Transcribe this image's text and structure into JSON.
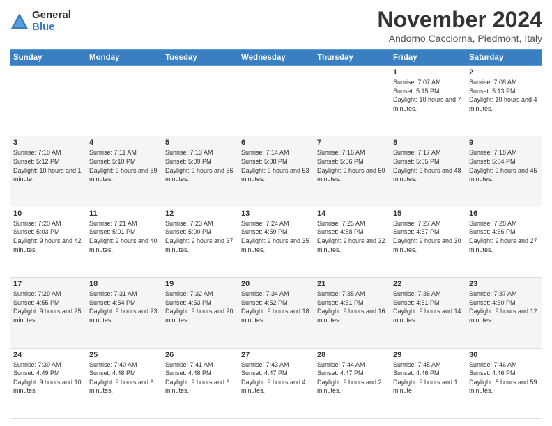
{
  "logo": {
    "general": "General",
    "blue": "Blue"
  },
  "title": "November 2024",
  "subtitle": "Andorno Cacciorna, Piedmont, Italy",
  "weekdays": [
    "Sunday",
    "Monday",
    "Tuesday",
    "Wednesday",
    "Thursday",
    "Friday",
    "Saturday"
  ],
  "weeks": [
    [
      {
        "day": "",
        "info": ""
      },
      {
        "day": "",
        "info": ""
      },
      {
        "day": "",
        "info": ""
      },
      {
        "day": "",
        "info": ""
      },
      {
        "day": "",
        "info": ""
      },
      {
        "day": "1",
        "info": "Sunrise: 7:07 AM\nSunset: 5:15 PM\nDaylight: 10 hours and 7 minutes."
      },
      {
        "day": "2",
        "info": "Sunrise: 7:08 AM\nSunset: 5:13 PM\nDaylight: 10 hours and 4 minutes."
      }
    ],
    [
      {
        "day": "3",
        "info": "Sunrise: 7:10 AM\nSunset: 5:12 PM\nDaylight: 10 hours and 1 minute."
      },
      {
        "day": "4",
        "info": "Sunrise: 7:11 AM\nSunset: 5:10 PM\nDaylight: 9 hours and 59 minutes."
      },
      {
        "day": "5",
        "info": "Sunrise: 7:13 AM\nSunset: 5:09 PM\nDaylight: 9 hours and 56 minutes."
      },
      {
        "day": "6",
        "info": "Sunrise: 7:14 AM\nSunset: 5:08 PM\nDaylight: 9 hours and 53 minutes."
      },
      {
        "day": "7",
        "info": "Sunrise: 7:16 AM\nSunset: 5:06 PM\nDaylight: 9 hours and 50 minutes."
      },
      {
        "day": "8",
        "info": "Sunrise: 7:17 AM\nSunset: 5:05 PM\nDaylight: 9 hours and 48 minutes."
      },
      {
        "day": "9",
        "info": "Sunrise: 7:18 AM\nSunset: 5:04 PM\nDaylight: 9 hours and 45 minutes."
      }
    ],
    [
      {
        "day": "10",
        "info": "Sunrise: 7:20 AM\nSunset: 5:03 PM\nDaylight: 9 hours and 42 minutes."
      },
      {
        "day": "11",
        "info": "Sunrise: 7:21 AM\nSunset: 5:01 PM\nDaylight: 9 hours and 40 minutes."
      },
      {
        "day": "12",
        "info": "Sunrise: 7:23 AM\nSunset: 5:00 PM\nDaylight: 9 hours and 37 minutes."
      },
      {
        "day": "13",
        "info": "Sunrise: 7:24 AM\nSunset: 4:59 PM\nDaylight: 9 hours and 35 minutes."
      },
      {
        "day": "14",
        "info": "Sunrise: 7:25 AM\nSunset: 4:58 PM\nDaylight: 9 hours and 32 minutes."
      },
      {
        "day": "15",
        "info": "Sunrise: 7:27 AM\nSunset: 4:57 PM\nDaylight: 9 hours and 30 minutes."
      },
      {
        "day": "16",
        "info": "Sunrise: 7:28 AM\nSunset: 4:56 PM\nDaylight: 9 hours and 27 minutes."
      }
    ],
    [
      {
        "day": "17",
        "info": "Sunrise: 7:29 AM\nSunset: 4:55 PM\nDaylight: 9 hours and 25 minutes."
      },
      {
        "day": "18",
        "info": "Sunrise: 7:31 AM\nSunset: 4:54 PM\nDaylight: 9 hours and 23 minutes."
      },
      {
        "day": "19",
        "info": "Sunrise: 7:32 AM\nSunset: 4:53 PM\nDaylight: 9 hours and 20 minutes."
      },
      {
        "day": "20",
        "info": "Sunrise: 7:34 AM\nSunset: 4:52 PM\nDaylight: 9 hours and 18 minutes."
      },
      {
        "day": "21",
        "info": "Sunrise: 7:35 AM\nSunset: 4:51 PM\nDaylight: 9 hours and 16 minutes."
      },
      {
        "day": "22",
        "info": "Sunrise: 7:36 AM\nSunset: 4:51 PM\nDaylight: 9 hours and 14 minutes."
      },
      {
        "day": "23",
        "info": "Sunrise: 7:37 AM\nSunset: 4:50 PM\nDaylight: 9 hours and 12 minutes."
      }
    ],
    [
      {
        "day": "24",
        "info": "Sunrise: 7:39 AM\nSunset: 4:49 PM\nDaylight: 9 hours and 10 minutes."
      },
      {
        "day": "25",
        "info": "Sunrise: 7:40 AM\nSunset: 4:48 PM\nDaylight: 9 hours and 8 minutes."
      },
      {
        "day": "26",
        "info": "Sunrise: 7:41 AM\nSunset: 4:48 PM\nDaylight: 9 hours and 6 minutes."
      },
      {
        "day": "27",
        "info": "Sunrise: 7:43 AM\nSunset: 4:47 PM\nDaylight: 9 hours and 4 minutes."
      },
      {
        "day": "28",
        "info": "Sunrise: 7:44 AM\nSunset: 4:47 PM\nDaylight: 9 hours and 2 minutes."
      },
      {
        "day": "29",
        "info": "Sunrise: 7:45 AM\nSunset: 4:46 PM\nDaylight: 9 hours and 1 minute."
      },
      {
        "day": "30",
        "info": "Sunrise: 7:46 AM\nSunset: 4:46 PM\nDaylight: 8 hours and 59 minutes."
      }
    ]
  ]
}
